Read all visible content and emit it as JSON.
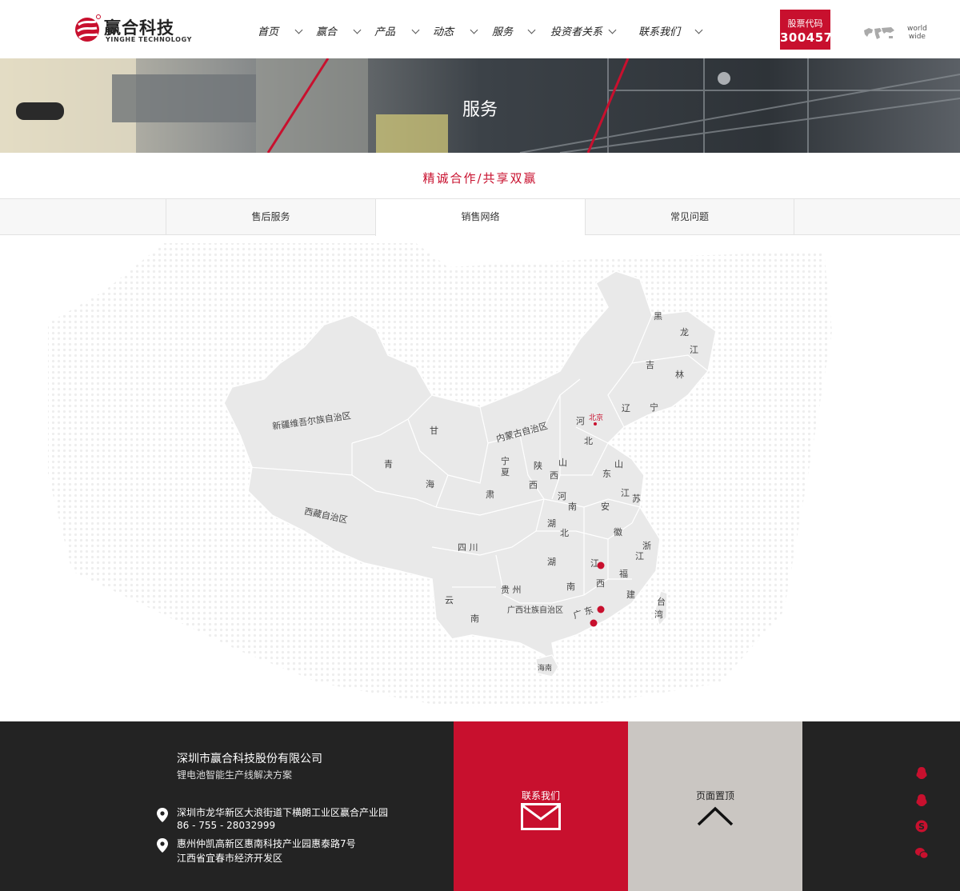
{
  "header": {
    "logo_cn": "赢合科技",
    "logo_en": "YINGHE TECHNOLOGY",
    "nav": [
      {
        "label": "首页"
      },
      {
        "label": "赢合"
      },
      {
        "label": "产品"
      },
      {
        "label": "动态"
      },
      {
        "label": "服务"
      },
      {
        "label": "投资者关系"
      },
      {
        "label": "联系我们"
      }
    ],
    "stock_label": "股票代码",
    "stock_code": "300457",
    "worldwide_line1": "world",
    "worldwide_line2": "wide"
  },
  "banner": {
    "title": "服务"
  },
  "slogan": "精诚合作/共享双赢",
  "tabs": [
    {
      "label": "售后服务",
      "active": false
    },
    {
      "label": "销售网络",
      "active": true
    },
    {
      "label": "常见问题",
      "active": false
    }
  ],
  "map": {
    "capital_label": "北京",
    "provinces": {
      "xinjiang": "新疆维吾尔族自治区",
      "xizang": "西藏自治区",
      "qinghai_1": "青",
      "qinghai_2": "海",
      "gansu_1": "甘",
      "gansu_2": "肃",
      "neimenggu": "内蒙古自治区",
      "ningxia_1": "宁",
      "ningxia_2": "夏",
      "shaanxi_1": "陕",
      "shaanxi_2": "西",
      "shanxi_1": "山",
      "shanxi_2": "西",
      "hebei_1": "河",
      "hebei_2": "北",
      "shandong_1": "山",
      "shandong_2": "东",
      "henan_1": "河",
      "henan_2": "南",
      "hubei_1": "湖",
      "hubei_2": "北",
      "hunan_1": "湖",
      "hunan_2": "南",
      "jiangxi_1": "江",
      "jiangxi_2": "西",
      "anhui_1": "安",
      "anhui_2": "徽",
      "jiangsu_1": "江",
      "jiangsu_2": "苏",
      "zhejiang_1": "浙",
      "zhejiang_2": "江",
      "fujian_1": "福",
      "fujian_2": "建",
      "sichuan": "四 川",
      "guizhou": "贵 州",
      "yunnan_1": "云",
      "yunnan_2": "南",
      "guangxi": "广西壮族自治区",
      "guangdong": "广 东",
      "hainan": "海南",
      "taiwan_1": "台",
      "taiwan_2": "湾",
      "heilongjiang_1": "黑",
      "heilongjiang_2": "龙",
      "heilongjiang_3": "江",
      "jilin_1": "吉",
      "jilin_2": "林",
      "liaoning_1": "辽",
      "liaoning_2": "宁"
    },
    "marker_color": "#c8102e",
    "markers": [
      "jiangxi",
      "guangdong-1",
      "guangdong-2"
    ]
  },
  "footer": {
    "company": "深圳市赢合科技股份有限公司",
    "tagline": "锂电池智能生产线解决方案",
    "address1": "深圳市龙华新区大浪街道下横朗工业区赢合产业园",
    "phone": "86 - 755 - 28032999",
    "address2": "惠州仲凯高新区惠南科技产业园惠泰路7号",
    "address3": "江西省宜春市经济开发区",
    "contact_label": "联系我们",
    "top_label": "页面置顶",
    "social_icons": [
      "qq-icon",
      "qq-icon",
      "skype-icon",
      "wechat-icon"
    ]
  },
  "colors": {
    "brand_red": "#c8102e",
    "footer_bg": "#232323",
    "top_block_bg": "#cac6c2"
  }
}
